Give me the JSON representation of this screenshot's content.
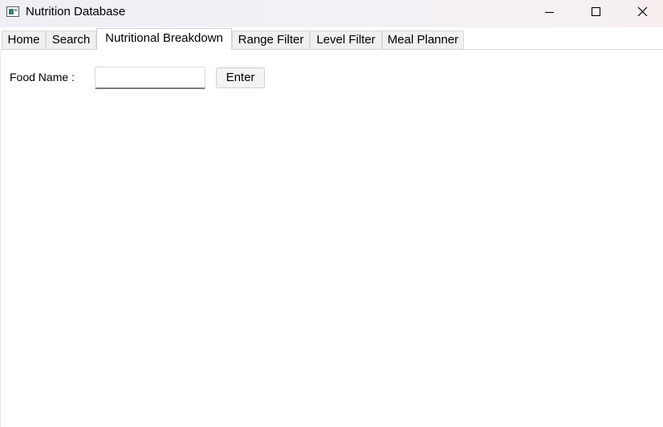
{
  "window": {
    "title": "Nutrition Database",
    "icon": "app-window-icon",
    "controls": {
      "minimize": "minimize-icon",
      "maximize": "maximize-icon",
      "close": "close-icon"
    }
  },
  "tabs": [
    {
      "label": "Home",
      "selected": false
    },
    {
      "label": "Search",
      "selected": false
    },
    {
      "label": "Nutritional Breakdown",
      "selected": true
    },
    {
      "label": "Range Filter",
      "selected": false
    },
    {
      "label": "Level Filter",
      "selected": false
    },
    {
      "label": "Meal Planner",
      "selected": false
    }
  ],
  "form": {
    "food_name_label": "Food Name :",
    "food_name_value": "",
    "enter_label": "Enter"
  }
}
